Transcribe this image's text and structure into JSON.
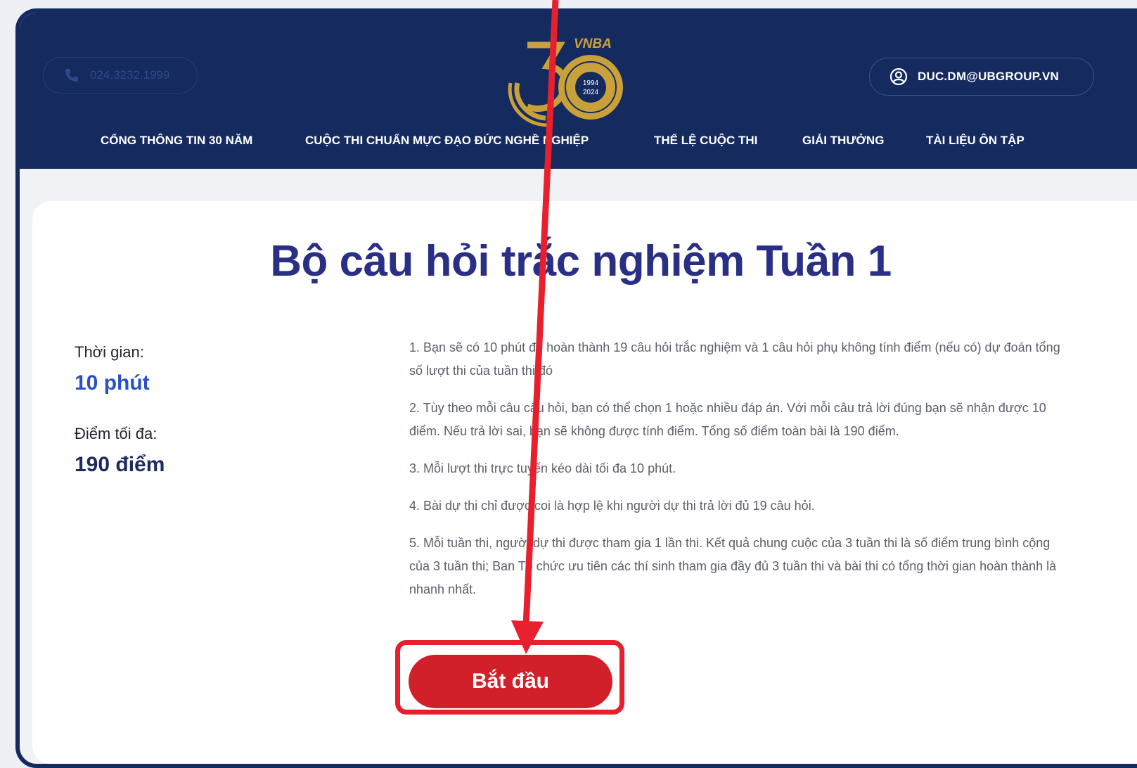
{
  "header": {
    "phone": "024.3232.1999",
    "logo_text": "VNBA",
    "logo_years": [
      "1994",
      "2024"
    ],
    "user_email": "DUC.DM@UBGROUP.VN"
  },
  "nav": {
    "items": [
      "CỔNG THÔNG TIN 30 NĂM",
      "CUỘC THI CHUẨN MỰC ĐẠO ĐỨC NGHỀ NGHIỆP",
      "THỂ LỆ CUỘC THI",
      "GIẢI THƯỞNG",
      "TÀI LIỆU ÔN TẬP"
    ]
  },
  "main": {
    "title": "Bộ câu hỏi trắc nghiệm Tuần 1",
    "time_label": "Thời gian:",
    "time_value": "10 phút",
    "score_label": "Điểm tối đa:",
    "score_value": "190 điểm",
    "rules": [
      "1. Bạn sẽ có 10 phút để hoàn thành 19 câu hỏi trắc nghiệm và 1 câu hỏi phụ không tính điểm (nếu có) dự đoán tổng số lượt thi của tuần thi đó",
      "2. Tùy theo mỗi câu câu hỏi, bạn có thể chọn 1 hoặc nhiều đáp án. Với mỗi câu trả lời đúng bạn sẽ nhận được 10 điểm. Nếu trả lời sai, bạn sẽ không được tính điểm. Tổng số điểm toàn bài là 190 điểm.",
      "3. Mỗi lượt thi trực tuyến kéo dài tối đa 10 phút.",
      "4. Bài dự thi chỉ được coi là hợp lệ khi người dự thi trả lời đủ 19 câu hỏi.",
      "5. Mỗi tuần thi, người dự thi được tham gia 1 lần thi. Kết quả chung cuộc của 3 tuần thi là số điểm trung bình cộng của 3 tuần thi; Ban Tổ chức ưu tiên các thí sinh tham gia đầy đủ 3 tuần thi và bài thi có tổng thời gian hoàn thành là nhanh nhất."
    ],
    "start_button": "Bắt đầu"
  },
  "colors": {
    "header_bg": "#152a5e",
    "title": "#2a2f86",
    "time_value": "#2b4fc9",
    "score_value": "#1d2b5e",
    "accent_red": "#d2202a",
    "annotation_red": "#e8202d",
    "gold": "#c9a13b"
  },
  "icons": {
    "phone": "phone-icon",
    "user": "user-circle-icon",
    "logo": "vnba-30-years-logo"
  }
}
